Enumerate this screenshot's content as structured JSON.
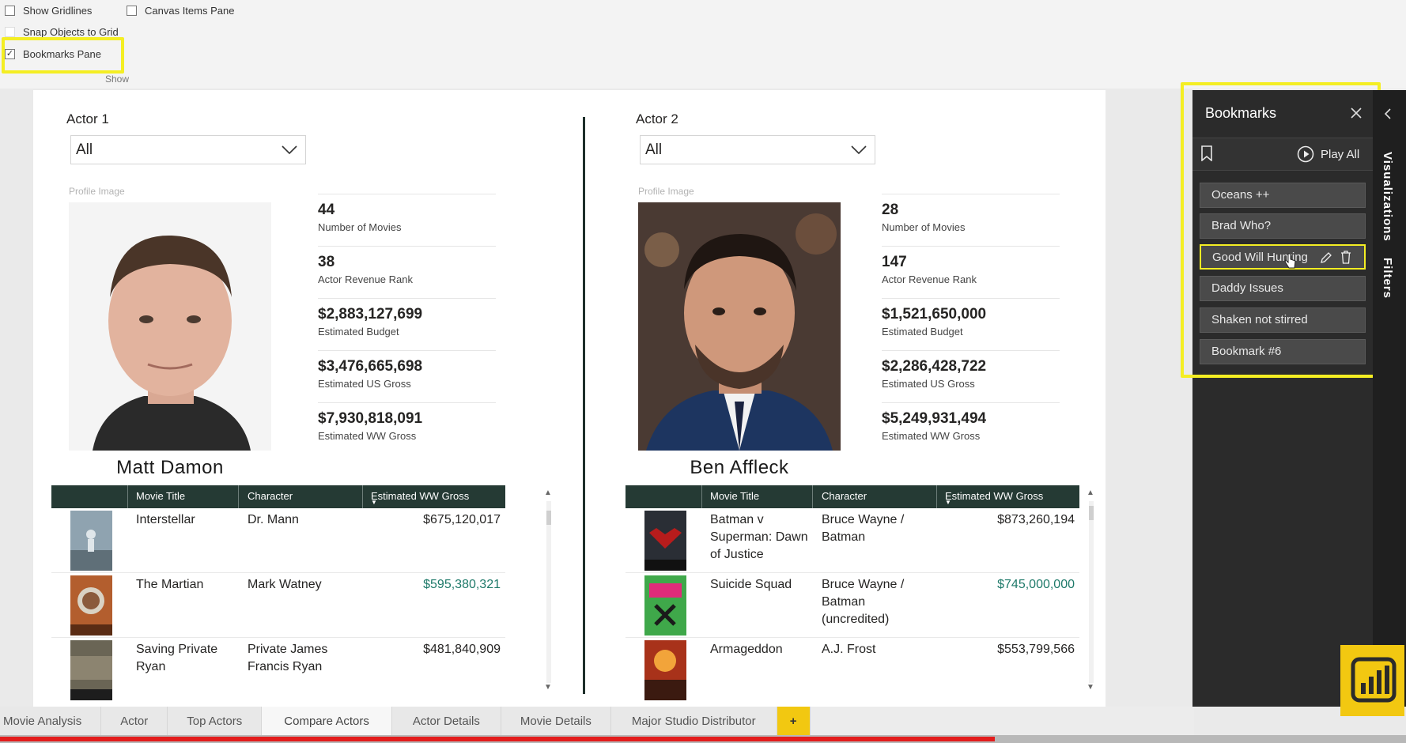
{
  "ribbon": {
    "show_gridlines": "Show Gridlines",
    "snap_objects": "Snap Objects to Grid",
    "bookmarks_pane": "Bookmarks Pane",
    "canvas_items": "Canvas Items Pane",
    "group_label": "Show",
    "bookmarks_pane_checked": true
  },
  "actor1": {
    "label": "Actor 1",
    "slicer_value": "All",
    "profile_label": "Profile Image",
    "name": "Matt Damon",
    "kpis": [
      {
        "value": "44",
        "caption": "Number of Movies"
      },
      {
        "value": "38",
        "caption": "Actor Revenue Rank"
      },
      {
        "value": "$2,883,127,699",
        "caption": "Estimated Budget"
      },
      {
        "value": "$3,476,665,698",
        "caption": "Estimated US Gross"
      },
      {
        "value": "$7,930,818,091",
        "caption": "Estimated WW Gross"
      }
    ],
    "table": {
      "headers": [
        "Movie Title",
        "Character",
        "Estimated WW Gross"
      ],
      "rows": [
        {
          "title": "Interstellar",
          "character": "Dr. Mann",
          "gross": "$675,120,017"
        },
        {
          "title": "The Martian",
          "character": "Mark Watney",
          "gross": "$595,380,321"
        },
        {
          "title": "Saving Private Ryan",
          "character": "Private James Francis Ryan",
          "gross": "$481,840,909"
        }
      ]
    }
  },
  "actor2": {
    "label": "Actor 2",
    "slicer_value": "All",
    "profile_label": "Profile Image",
    "name": "Ben Affleck",
    "kpis": [
      {
        "value": "28",
        "caption": "Number of Movies"
      },
      {
        "value": "147",
        "caption": "Actor Revenue Rank"
      },
      {
        "value": "$1,521,650,000",
        "caption": "Estimated Budget"
      },
      {
        "value": "$2,286,428,722",
        "caption": "Estimated US Gross"
      },
      {
        "value": "$5,249,931,494",
        "caption": "Estimated WW Gross"
      }
    ],
    "table": {
      "headers": [
        "Movie Title",
        "Character",
        "Estimated WW Gross"
      ],
      "rows": [
        {
          "title": "Batman v Superman: Dawn of Justice",
          "character": "Bruce Wayne / Batman",
          "gross": "$873,260,194"
        },
        {
          "title": "Suicide Squad",
          "character": "Bruce Wayne / Batman (uncredited)",
          "gross": "$745,000,000"
        },
        {
          "title": "Armageddon",
          "character": "A.J. Frost",
          "gross": "$553,799,566"
        }
      ]
    }
  },
  "bookmarks": {
    "title": "Bookmarks",
    "play_all": "Play All",
    "items": [
      "Oceans ++",
      "Brad Who?",
      "Good Will Hunting",
      "Daddy Issues",
      "Shaken not stirred",
      "Bookmark #6"
    ],
    "active_index": 2
  },
  "side_panels": {
    "visualizations": "Visualizations",
    "filters": "Filters"
  },
  "tabs": [
    "Movie Analysis",
    "Actor",
    "Top Actors",
    "Compare Actors",
    "Actor Details",
    "Movie Details",
    "Major Studio Distributor"
  ],
  "active_tab": "Compare Actors",
  "add_tab": "+",
  "colors": {
    "accent_yellow": "#f4ee23",
    "table_header": "#253a34",
    "pane_bg": "#2b2b2b",
    "teal_value": "#1f7a6a",
    "powerbi_yellow": "#f2c811"
  }
}
